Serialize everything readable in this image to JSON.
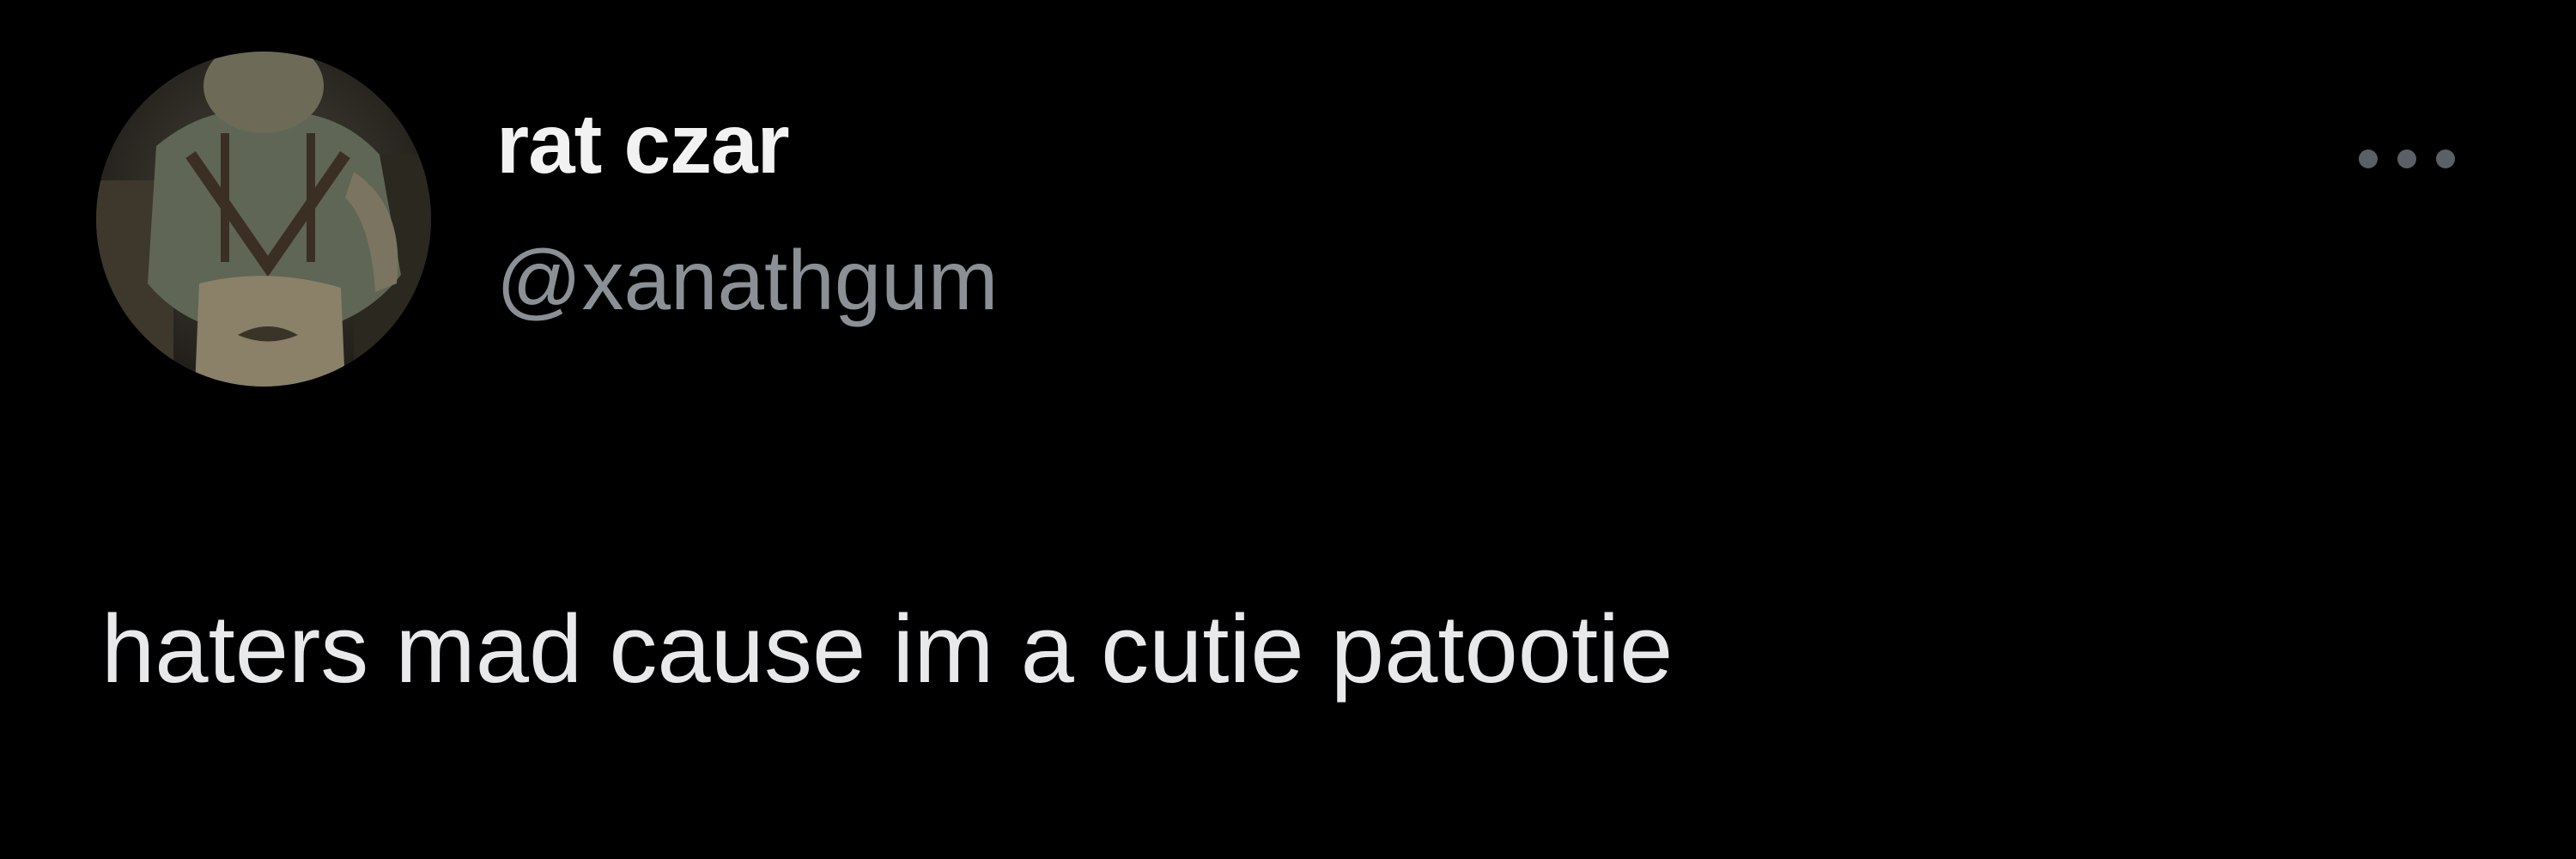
{
  "tweet": {
    "author": {
      "display_name": "rat czar",
      "handle": "@xanathgum",
      "avatar_icon": "avatar-photo"
    },
    "more_icon": "ellipsis-icon",
    "text": "haters mad cause im a cutie patootie"
  },
  "colors": {
    "background": "#000000",
    "display_name": "#f2f2f2",
    "handle": "#8b9096",
    "text": "#e7e9ea",
    "more_icon": "#5b6066"
  }
}
